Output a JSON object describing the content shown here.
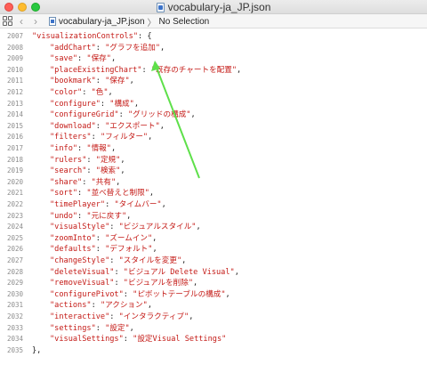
{
  "window": {
    "title": "vocabulary-ja_JP.json",
    "traffic_lights": [
      "close",
      "minimize",
      "zoom"
    ]
  },
  "toolbar": {
    "back_icon": "chevron-left-icon",
    "forward_icon": "chevron-right-icon",
    "file_name": "vocabulary-ja_JP.json",
    "separator": "〉",
    "selection": "No Selection"
  },
  "editor": {
    "open_line": {
      "number": "2007",
      "key": "\"visualizationControls\"",
      "rest": ": {"
    },
    "entries": [
      {
        "number": "2008",
        "key": "\"addChart\"",
        "value": "\"グラフを追加\""
      },
      {
        "number": "2009",
        "key": "\"save\"",
        "value": "\"保存\""
      },
      {
        "number": "2010",
        "key": "\"placeExistingChart\"",
        "value": "\"既存のチャートを配置\""
      },
      {
        "number": "2011",
        "key": "\"bookmark\"",
        "value": "\"保存\""
      },
      {
        "number": "2012",
        "key": "\"color\"",
        "value": "\"色\""
      },
      {
        "number": "2013",
        "key": "\"configure\"",
        "value": "\"構成\""
      },
      {
        "number": "2014",
        "key": "\"configureGrid\"",
        "value": "\"グリッドの構成\""
      },
      {
        "number": "2015",
        "key": "\"download\"",
        "value": "\"エクスポート\""
      },
      {
        "number": "2016",
        "key": "\"filters\"",
        "value": "\"フィルター\""
      },
      {
        "number": "2017",
        "key": "\"info\"",
        "value": "\"情報\""
      },
      {
        "number": "2018",
        "key": "\"rulers\"",
        "value": "\"定規\""
      },
      {
        "number": "2019",
        "key": "\"search\"",
        "value": "\"検索\""
      },
      {
        "number": "2020",
        "key": "\"share\"",
        "value": "\"共有\""
      },
      {
        "number": "2021",
        "key": "\"sort\"",
        "value": "\"並べ替えと制限\""
      },
      {
        "number": "2022",
        "key": "\"timePlayer\"",
        "value": "\"タイムバー\""
      },
      {
        "number": "2023",
        "key": "\"undo\"",
        "value": "\"元に戻す\""
      },
      {
        "number": "2024",
        "key": "\"visualStyle\"",
        "value": "\"ビジュアルスタイル\""
      },
      {
        "number": "2025",
        "key": "\"zoomInto\"",
        "value": "\"ズームイン\""
      },
      {
        "number": "2026",
        "key": "\"defaults\"",
        "value": "\"デフォルト\""
      },
      {
        "number": "2027",
        "key": "\"changeStyle\"",
        "value": "\"スタイルを変更\""
      },
      {
        "number": "2028",
        "key": "\"deleteVisual\"",
        "value": "\"ビジュアル Delete Visual\""
      },
      {
        "number": "2029",
        "key": "\"removeVisual\"",
        "value": "\"ビジュアルを削除\""
      },
      {
        "number": "2030",
        "key": "\"configurePivot\"",
        "value": "\"ピボットテーブルの構成\""
      },
      {
        "number": "2031",
        "key": "\"actions\"",
        "value": "\"アクション\""
      },
      {
        "number": "2032",
        "key": "\"interactive\"",
        "value": "\"インタラクティブ\""
      },
      {
        "number": "2033",
        "key": "\"settings\"",
        "value": "\"設定\""
      },
      {
        "number": "2034",
        "key": "\"visualSettings\"",
        "value": "\"設定Visual Settings\"",
        "last": true
      }
    ],
    "close_line": {
      "number": "2035",
      "text": "},"
    }
  },
  "colors": {
    "string": "#c41a16",
    "annotation_arrow": "#5ee04a"
  }
}
